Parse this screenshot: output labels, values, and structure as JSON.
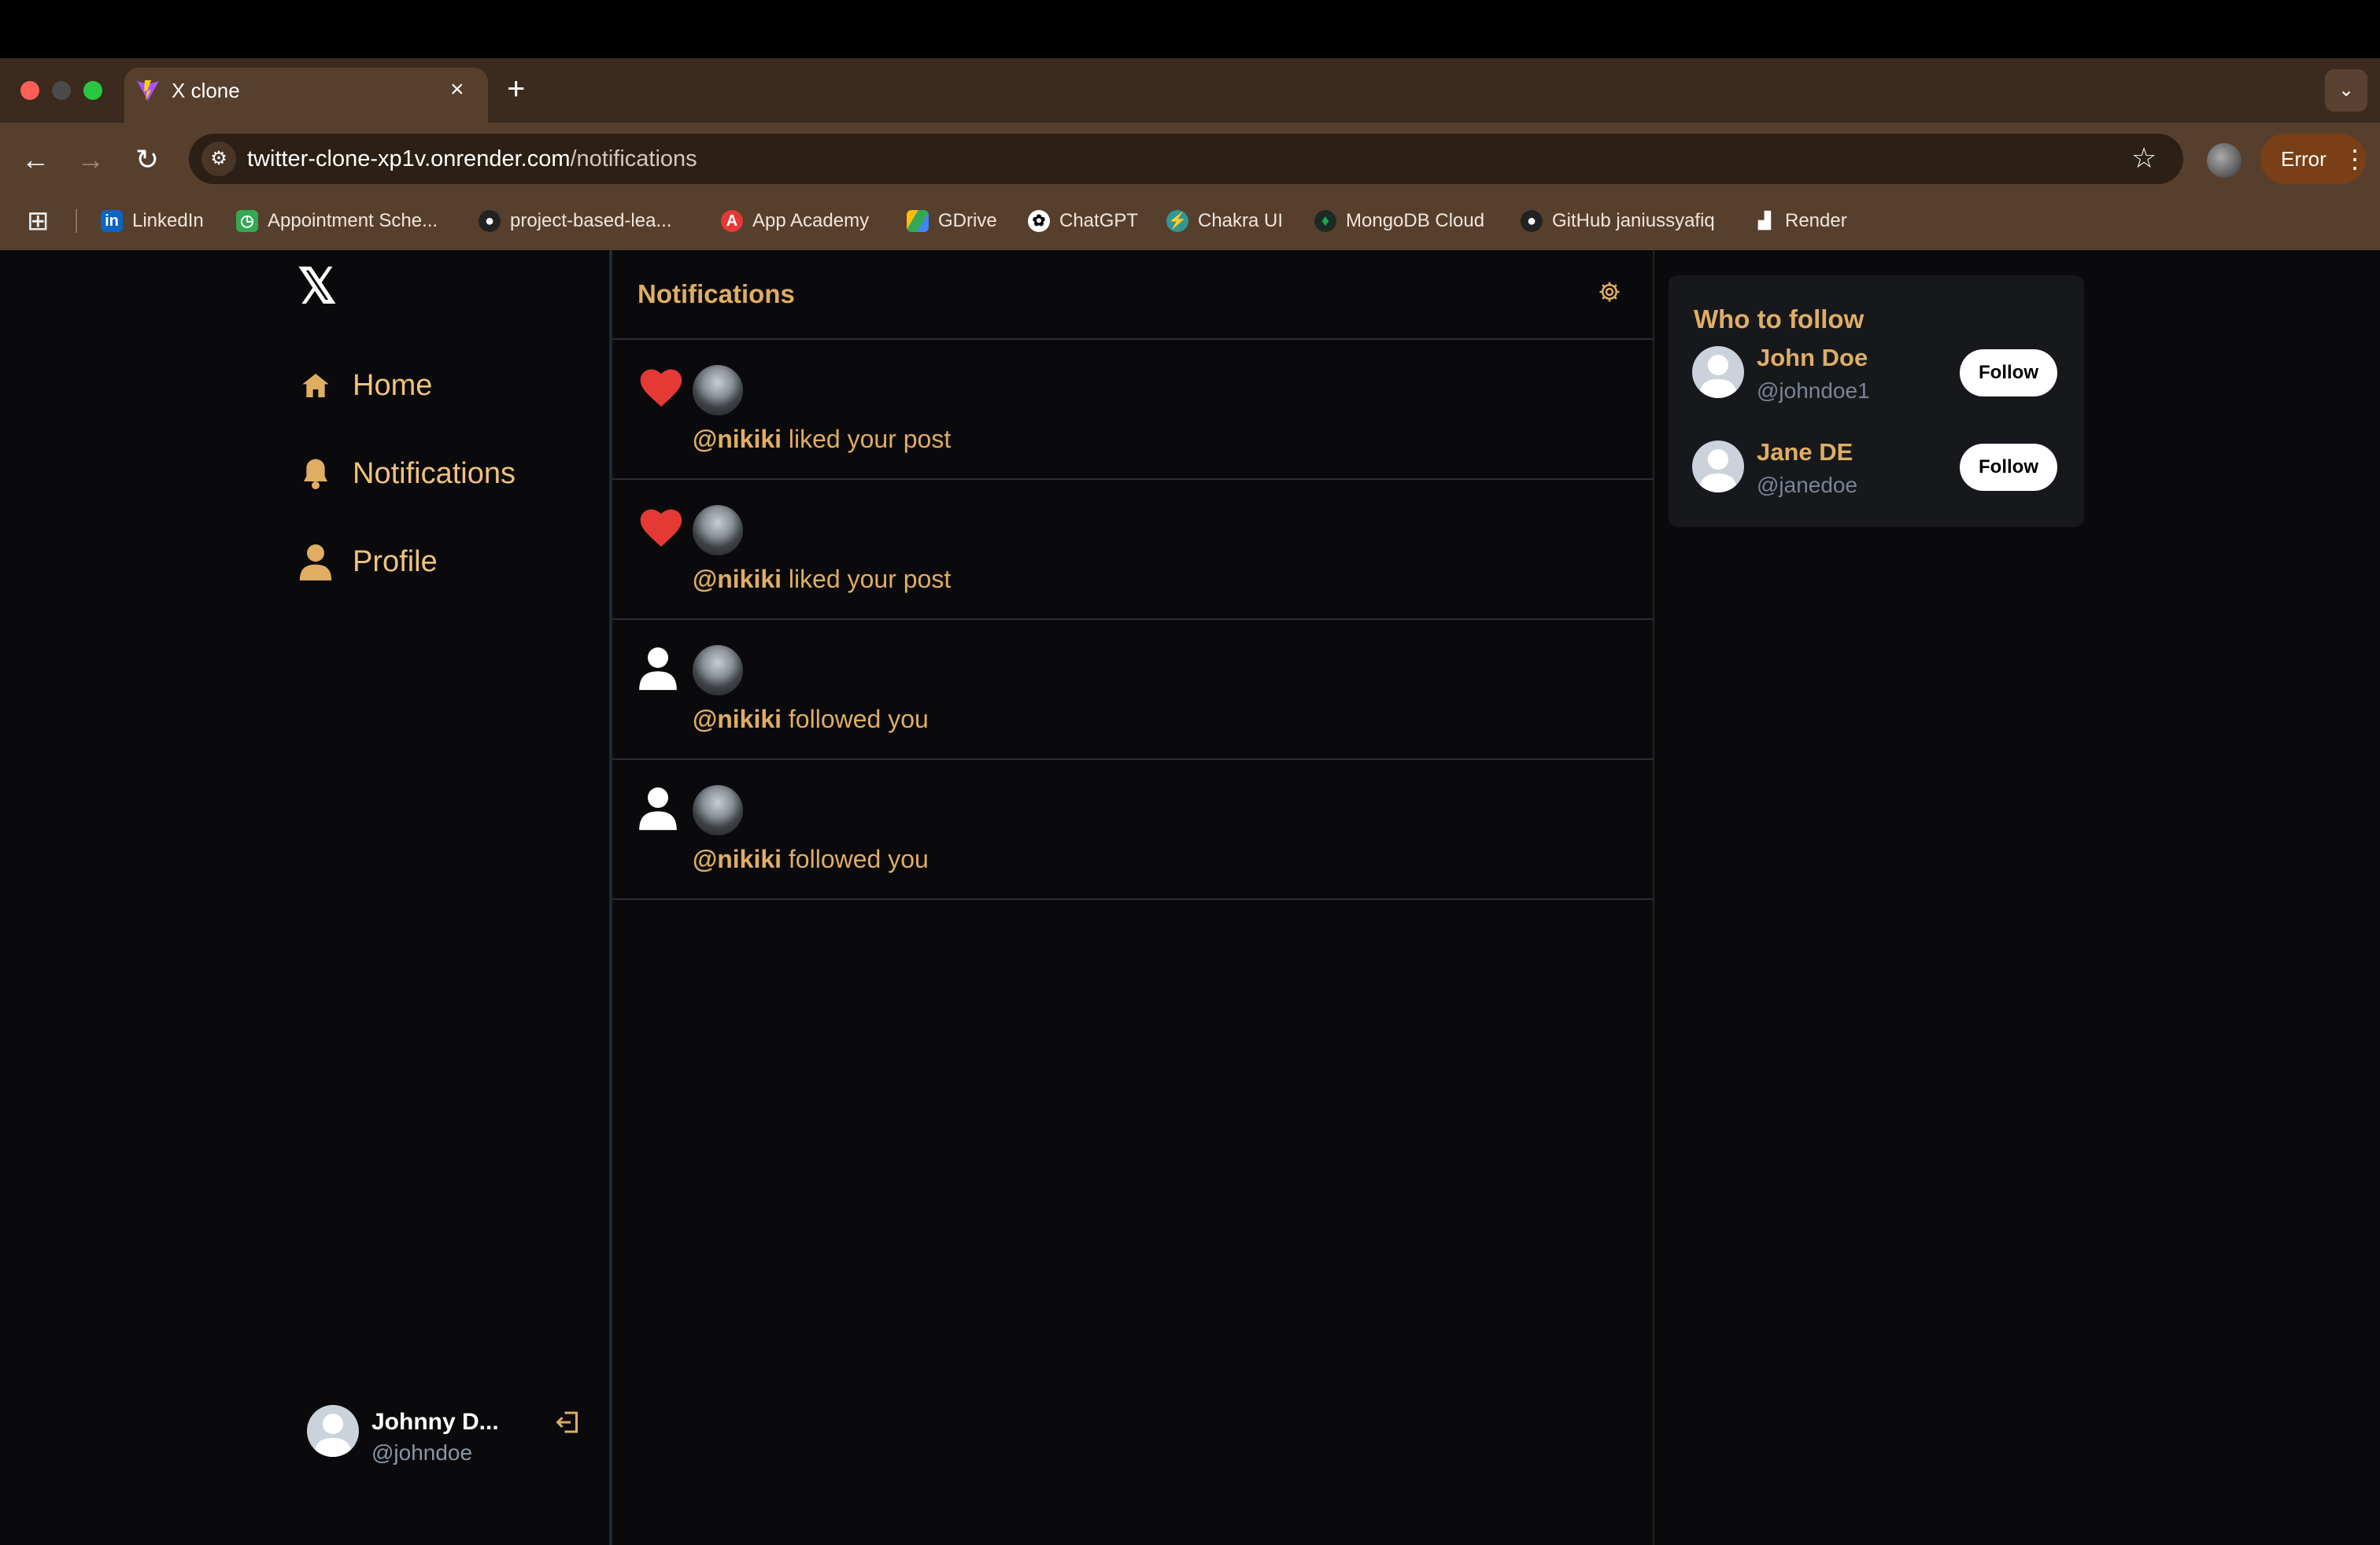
{
  "browser": {
    "tab_title": "X clone",
    "tab_close": "×",
    "new_tab": "+",
    "url_host": "twitter-clone-xp1v.onrender.com",
    "url_path": "/notifications",
    "error_label": "Error",
    "bookmarks": [
      {
        "label": "LinkedIn",
        "icon": "linkedin-icon",
        "color": "#0a66c2"
      },
      {
        "label": "Appointment Sche...",
        "icon": "appointment-icon",
        "color": "#34a853"
      },
      {
        "label": "project-based-lea...",
        "icon": "github-icon",
        "color": "#000000"
      },
      {
        "label": "App Academy",
        "icon": "app-academy-icon",
        "color": "#e53935"
      },
      {
        "label": "GDrive",
        "icon": "gdrive-icon",
        "color": "#fbbc04"
      },
      {
        "label": "ChatGPT",
        "icon": "chatgpt-icon",
        "color": "#ffffff"
      },
      {
        "label": "Chakra UI",
        "icon": "chakra-icon",
        "color": "#319795"
      },
      {
        "label": "MongoDB Cloud",
        "icon": "mongodb-icon",
        "color": "#00684a"
      },
      {
        "label": "GitHub janiussyafiq",
        "icon": "github-icon",
        "color": "#000000"
      },
      {
        "label": "Render",
        "icon": "render-icon",
        "color": "#ffffff"
      }
    ]
  },
  "sidebar": {
    "items": [
      {
        "label": "Home",
        "icon": "home-icon"
      },
      {
        "label": "Notifications",
        "icon": "bell-icon"
      },
      {
        "label": "Profile",
        "icon": "user-icon"
      }
    ],
    "user": {
      "name": "Johnny D...",
      "handle": "@johndoe"
    }
  },
  "notifications": {
    "title": "Notifications",
    "items": [
      {
        "type": "like",
        "icon": "heart-icon",
        "username": "@nikiki",
        "text": " liked your post"
      },
      {
        "type": "like",
        "icon": "heart-icon",
        "username": "@nikiki",
        "text": " liked your post"
      },
      {
        "type": "follow",
        "icon": "user-icon",
        "username": "@nikiki",
        "text": " followed you"
      },
      {
        "type": "follow",
        "icon": "user-icon",
        "username": "@nikiki",
        "text": " followed you"
      }
    ]
  },
  "who_to_follow": {
    "title": "Who to follow",
    "users": [
      {
        "name": "John Doe",
        "handle": "@johndoe1",
        "button": "Follow"
      },
      {
        "name": "Jane DE",
        "handle": "@janedoe",
        "button": "Follow"
      }
    ]
  },
  "colors": {
    "accent": "#e0ad63",
    "background": "#0a0a0c",
    "heart": "#e53935"
  }
}
